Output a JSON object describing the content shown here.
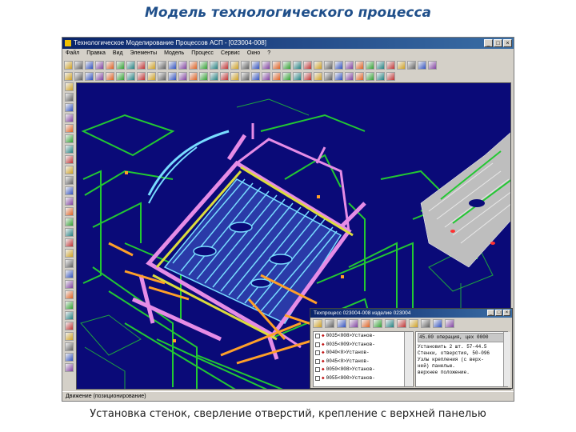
{
  "slide": {
    "title": "Модель технологического процесса",
    "caption": "Установка стенок, сверление отверстий, крепление с верхней панелью"
  },
  "app": {
    "window_title": "Технологическое Моделирование Процессов АСП - [023004-008]",
    "menu": [
      "Файл",
      "Правка",
      "Вид",
      "Элементы",
      "Модель",
      "Процесс",
      "Сервис",
      "Окно",
      "?"
    ],
    "status": "Движение (позиционирование)",
    "controls": {
      "minimize": "_",
      "maximize": "□",
      "close": "×"
    }
  },
  "subwindow": {
    "title": "Техпроцесс 023004-008 изделие 023004",
    "tree_items": [
      "0035<008>Установ-",
      "0035<009>Установ-",
      "0040<0>Установ-",
      "0045<0>Установ-",
      "0050<008>Установ-",
      "0055<000>Установ-"
    ],
    "text_header": "45.00 операция, цех 0000",
    "text_lines": [
      "Установить 2 шт. 57-44.5",
      "Стенки, отверстия, 50-096",
      "Узлы крепления (с верх-",
      "ней) панелью.",
      "",
      "верхнее положение."
    ]
  },
  "colors": {
    "viewport_bg": "#0a0a78",
    "fixture_green": "#22c832",
    "frame_magenta": "#e68ce6",
    "panel_cyan": "#78dcff",
    "part_orange": "#ffa028",
    "beam_yellow": "#dcdc3c",
    "skin_gray": "#bebebe"
  }
}
